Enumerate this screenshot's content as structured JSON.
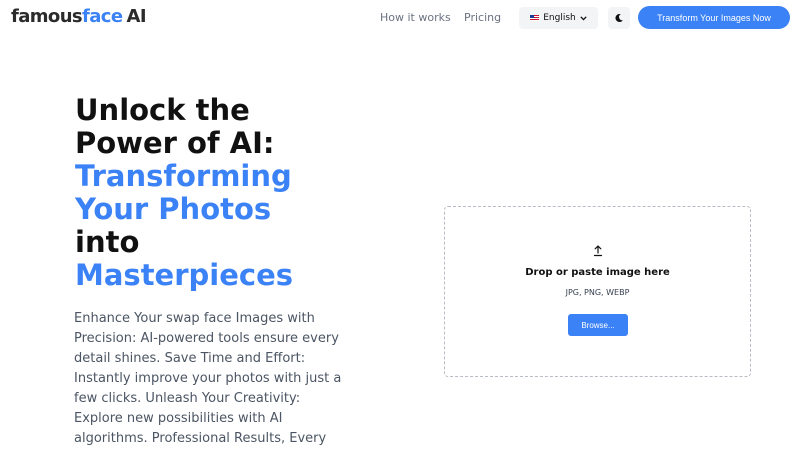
{
  "header": {
    "logo": {
      "part1": "famous",
      "part2": "face",
      "part3": "AI"
    },
    "nav": {
      "how_it_works": "How it works",
      "pricing": "Pricing"
    },
    "language": {
      "flag_icon": "us-flag-icon",
      "label": "English",
      "chevron_icon": "chevron-down-icon"
    },
    "theme_toggle_icon": "moon-icon",
    "cta_label": "Transform Your Images Now"
  },
  "hero": {
    "title_lines": [
      {
        "text": "Unlock the",
        "accent": false
      },
      {
        "text": "Power of AI:",
        "accent": false
      },
      {
        "text": "Transforming",
        "accent": true
      },
      {
        "text": "Your Photos",
        "accent": true
      },
      {
        "text": "into",
        "accent": false
      },
      {
        "text": "Masterpieces",
        "accent": true
      }
    ],
    "description": "Enhance Your swap face Images with Precision: AI-powered tools ensure every detail shines. Save Time and Effort: Instantly improve your photos with just a few clicks. Unleash Your Creativity: Explore new possibilities with AI algorithms. Professional Results, Every"
  },
  "upload": {
    "icon": "upload-icon",
    "title": "Drop or paste image here",
    "formats": "JPG, PNG, WEBP",
    "browse_label": "Browse..."
  },
  "colors": {
    "accent": "#3b82f6",
    "text": "#111111",
    "muted": "#6b7280"
  }
}
